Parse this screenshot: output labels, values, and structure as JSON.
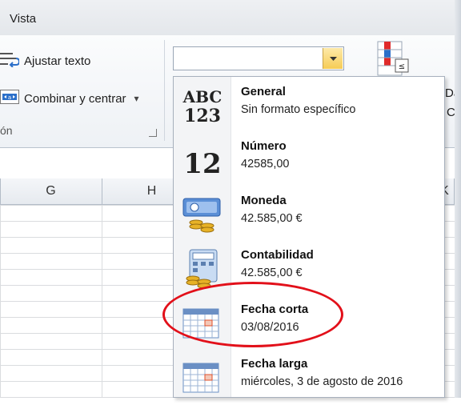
{
  "ribbon": {
    "tab_label": "Vista",
    "wrap_text_label": "Ajustar texto",
    "merge_center_label": "Combinar y centrar",
    "merge_dropdown_glyph": "▾",
    "group_label_partial": "ón",
    "number_format_value": "",
    "truncated_da": "Da",
    "truncated_c": "C"
  },
  "sheet": {
    "columns": [
      {
        "label": ""
      },
      {
        "label": "G"
      },
      {
        "label": "H"
      },
      {
        "label": ""
      },
      {
        "label": "K"
      }
    ]
  },
  "number_format_gallery": {
    "options": [
      {
        "icon": "general-abc123-icon",
        "title": "General",
        "example": "Sin formato específico"
      },
      {
        "icon": "number-12-icon",
        "title": "Número",
        "example": "42585,00"
      },
      {
        "icon": "currency-icon",
        "title": "Moneda",
        "example": "42.585,00 €"
      },
      {
        "icon": "accounting-icon",
        "title": "Contabilidad",
        "example": " 42.585,00 €"
      },
      {
        "icon": "short-date-calendar-icon",
        "title": "Fecha corta",
        "example": "03/08/2016"
      },
      {
        "icon": "long-date-calendar-icon",
        "title": "Fecha larga",
        "example": "miércoles, 3 de agosto de 2016"
      }
    ],
    "general_icon_text": {
      "line1": "ABC",
      "line2": "123"
    },
    "number_icon_text": "12",
    "highlighted_option": "Fecha corta",
    "highlight_color": "#e2101a"
  }
}
